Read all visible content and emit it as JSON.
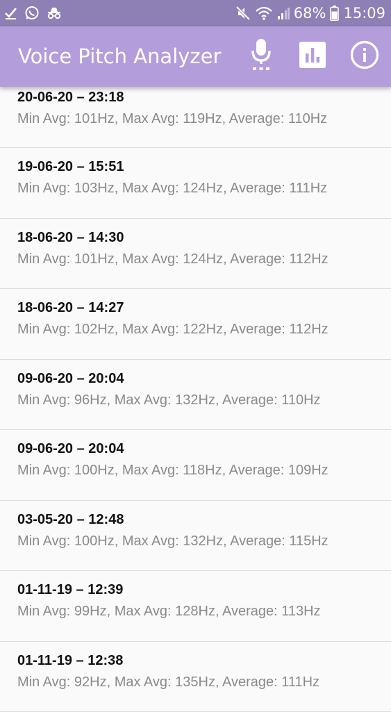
{
  "status_bar": {
    "battery": "68%",
    "time": "15:09",
    "icons": [
      "check-icon",
      "whatsapp-icon",
      "incognito-icon",
      "mute-icon",
      "wifi-icon",
      "signal-icon",
      "battery-icon"
    ]
  },
  "app_bar": {
    "title": "Voice Pitch Analyzer",
    "background": "#b39ddb",
    "actions": [
      "microphone-icon",
      "bar-chart-icon",
      "info-icon"
    ]
  },
  "recordings": [
    {
      "date": "20-06-20 – 23:18",
      "stats": "Min Avg: 101Hz, Max Avg: 119Hz, Average: 110Hz"
    },
    {
      "date": "19-06-20 – 15:51",
      "stats": "Min Avg: 103Hz, Max Avg: 124Hz, Average: 111Hz"
    },
    {
      "date": "18-06-20 – 14:30",
      "stats": "Min Avg: 101Hz, Max Avg: 124Hz, Average: 112Hz"
    },
    {
      "date": "18-06-20 – 14:27",
      "stats": "Min Avg: 102Hz, Max Avg: 122Hz, Average: 112Hz"
    },
    {
      "date": "09-06-20 – 20:04",
      "stats": "Min Avg: 96Hz, Max Avg: 132Hz, Average: 110Hz"
    },
    {
      "date": "09-06-20 – 20:04",
      "stats": "Min Avg: 100Hz, Max Avg: 118Hz, Average: 109Hz"
    },
    {
      "date": "03-05-20 – 12:48",
      "stats": "Min Avg: 100Hz, Max Avg: 132Hz, Average: 115Hz"
    },
    {
      "date": "01-11-19 – 12:39",
      "stats": "Min Avg: 99Hz, Max Avg: 128Hz, Average: 113Hz"
    },
    {
      "date": "01-11-19 – 12:38",
      "stats": "Min Avg: 92Hz, Max Avg: 135Hz, Average: 111Hz"
    }
  ]
}
